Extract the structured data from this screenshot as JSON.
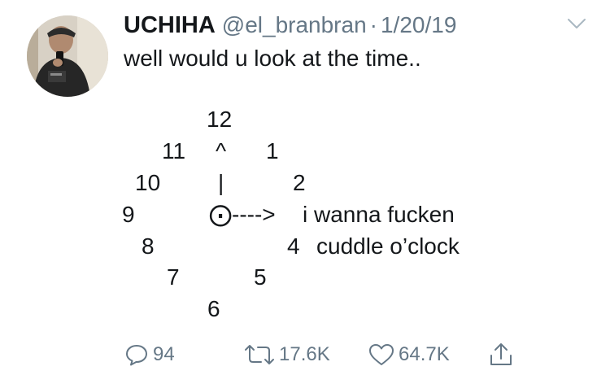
{
  "tweet": {
    "display_name": "UCHIHA",
    "handle": "@el_branbran",
    "separator": "·",
    "date": "1/20/19",
    "text_line1": "well would u look at the time..",
    "clock": {
      "n12": "12",
      "n11": "11",
      "arrow_up": "^",
      "n1": "1",
      "n10": "10",
      "stem": "|",
      "n2": "2",
      "n9": "9",
      "center_arrow": "⨀---->",
      "line_a": "i wanna fucken",
      "n8": "8",
      "n4": "4",
      "line_b": "cuddle o’clock",
      "n7": "7",
      "n5": "5",
      "n6": "6"
    }
  },
  "actions": {
    "reply_count": "94",
    "retweet_count": "17.6K",
    "like_count": "64.7K"
  },
  "icons": {
    "reply": "reply-icon",
    "retweet": "retweet-icon",
    "like": "heart-icon",
    "share": "share-icon",
    "menu": "chevron-down-icon"
  }
}
